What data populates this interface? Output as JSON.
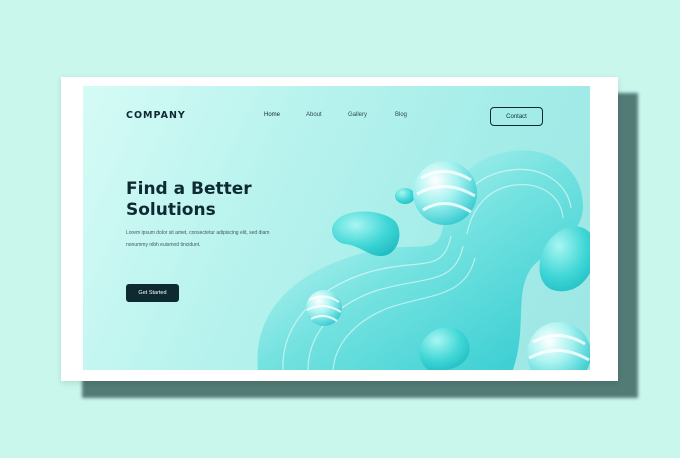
{
  "brand": {
    "name": "COMPANY"
  },
  "nav": {
    "items": [
      "Home",
      "About",
      "Gallery",
      "Blog"
    ],
    "contact_label": "Contact"
  },
  "hero": {
    "title_line1": "Find a Better",
    "title_line2": "Solutions",
    "subtitle": "Lorem ipsum dolor sit amet, consectetur adipiscing elit, sed diam nonummy nibh euismod tincidunt.",
    "cta_label": "Get Started"
  },
  "colors": {
    "background": "#c9f7ec",
    "dark_navy": "#0d2a33",
    "accent_teal": "#3fd6d6"
  }
}
